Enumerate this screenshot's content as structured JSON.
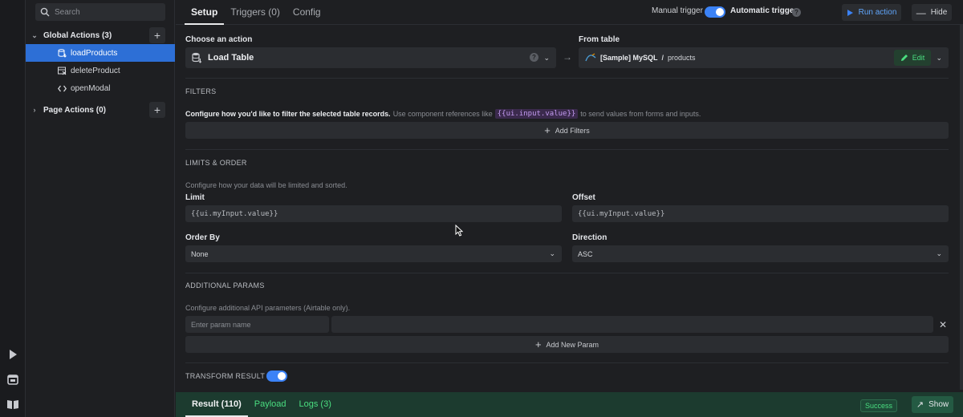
{
  "sidebar": {
    "search_placeholder": "Search",
    "global_section": "Global Actions (3)",
    "page_section": "Page Actions (0)",
    "items": [
      {
        "label": "loadProducts"
      },
      {
        "label": "deleteProduct"
      },
      {
        "label": "openModal"
      }
    ]
  },
  "topbar": {
    "tabs": [
      "Setup",
      "Triggers (0)",
      "Config"
    ],
    "manual_trigger": "Manual trigger",
    "automatic_trigger": "Automatic trigger",
    "run_action": "Run action",
    "hide": "Hide"
  },
  "action": {
    "choose_label": "Choose an action",
    "selected": "Load Table",
    "from_table_label": "From table",
    "datasource": "[Sample] MySQL",
    "separator": "/",
    "table": "products",
    "edit": "Edit"
  },
  "filters": {
    "heading": "FILTERS",
    "desc_bold": "Configure how you'd like to filter the selected table records.",
    "desc_pre": "Use component references like",
    "desc_code": "{{ui.input.value}}",
    "desc_post": "to send values from forms and inputs.",
    "add": "Add Filters"
  },
  "limits": {
    "heading": "LIMITS & ORDER",
    "desc": "Configure how your data will be limited and sorted.",
    "limit_label": "Limit",
    "limit_placeholder": "{{ui.myInput.value}}",
    "offset_label": "Offset",
    "offset_placeholder": "{{ui.myInput.value}}",
    "orderby_label": "Order By",
    "orderby_value": "None",
    "direction_label": "Direction",
    "direction_value": "ASC"
  },
  "params": {
    "heading": "ADDITIONAL PARAMS",
    "desc": "Configure additional API parameters (Airtable only).",
    "name_placeholder": "Enter param name",
    "add": "Add New Param"
  },
  "transform": {
    "heading": "TRANSFORM RESULT"
  },
  "footer": {
    "tabs": [
      "Result (110)",
      "Payload",
      "Logs (3)"
    ],
    "status": "Success",
    "show": "Show"
  },
  "colors": {
    "accent": "#3b82f6",
    "selected_item": "#2d6fd6",
    "success": "#4ade80",
    "footer_bg": "#1c3b2f"
  }
}
